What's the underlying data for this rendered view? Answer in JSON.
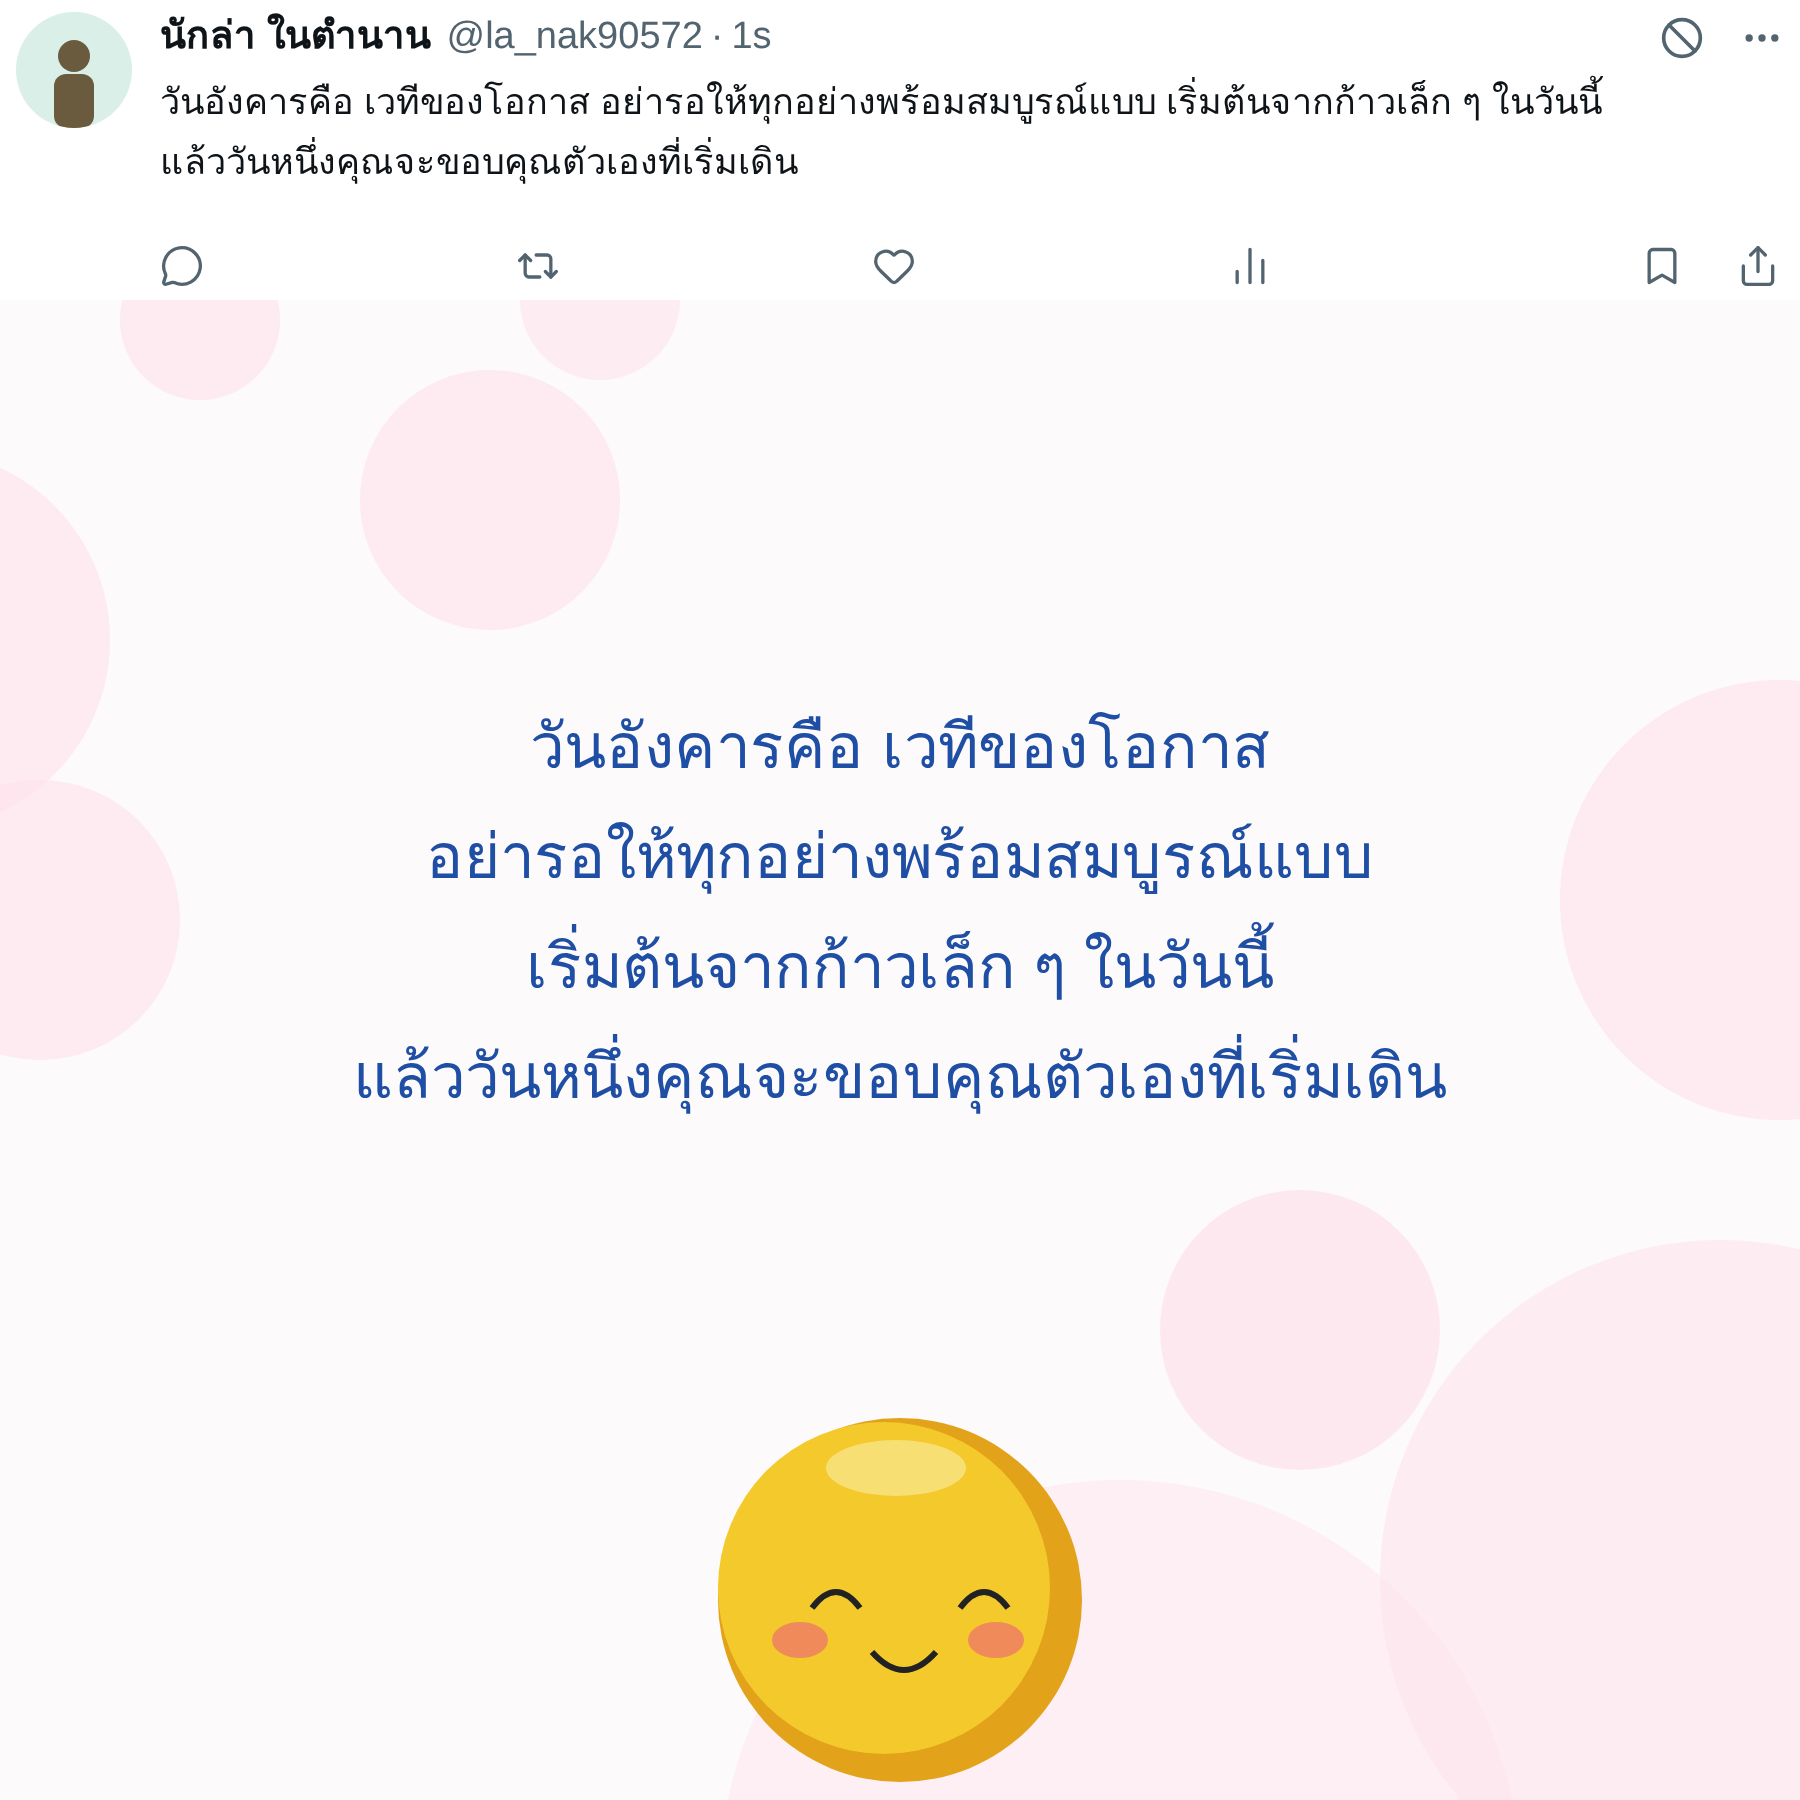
{
  "post": {
    "display_name": "นักล่า ในตำนาน",
    "handle": "@la_nak90572",
    "separator": "·",
    "time": "1s",
    "text": "วันอังคารคือ เวทีของโอกาส อย่ารอให้ทุกอย่างพร้อมสมบูรณ์แบบ เริ่มต้นจากก้าวเล็ก ๆ ในวันนี้ แล้ววันหนึ่งคุณจะขอบคุณตัวเองที่เริ่มเดิน"
  },
  "actions": [
    {
      "kind": "reply"
    },
    {
      "kind": "repost"
    },
    {
      "kind": "like"
    },
    {
      "kind": "views"
    },
    {
      "kind": "bookmark"
    },
    {
      "kind": "share"
    }
  ],
  "image": {
    "quote_lines": [
      "วันอังคารคือ เวทีของโอกาส",
      "อย่ารอให้ทุกอย่างพร้อมสมบูรณ์แบบ",
      "เริ่มต้นจากก้าวเล็ก ๆ ในวันนี้",
      "แล้ววันหนึ่งคุณจะขอบคุณตัวเองที่เริ่มเดิน"
    ]
  }
}
